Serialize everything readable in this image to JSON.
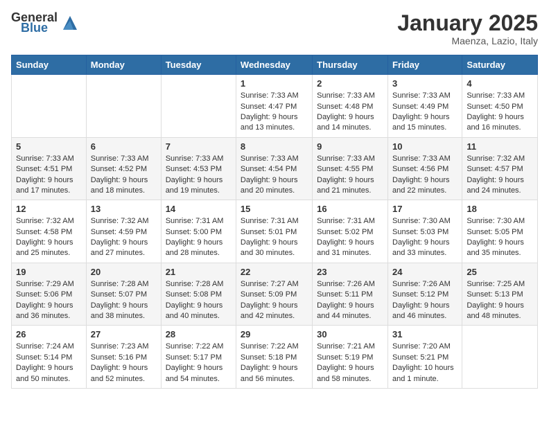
{
  "header": {
    "logo_general": "General",
    "logo_blue": "Blue",
    "month": "January 2025",
    "location": "Maenza, Lazio, Italy"
  },
  "weekdays": [
    "Sunday",
    "Monday",
    "Tuesday",
    "Wednesday",
    "Thursday",
    "Friday",
    "Saturday"
  ],
  "weeks": [
    [
      {
        "day": "",
        "info": ""
      },
      {
        "day": "",
        "info": ""
      },
      {
        "day": "",
        "info": ""
      },
      {
        "day": "1",
        "info": "Sunrise: 7:33 AM\nSunset: 4:47 PM\nDaylight: 9 hours and 13 minutes."
      },
      {
        "day": "2",
        "info": "Sunrise: 7:33 AM\nSunset: 4:48 PM\nDaylight: 9 hours and 14 minutes."
      },
      {
        "day": "3",
        "info": "Sunrise: 7:33 AM\nSunset: 4:49 PM\nDaylight: 9 hours and 15 minutes."
      },
      {
        "day": "4",
        "info": "Sunrise: 7:33 AM\nSunset: 4:50 PM\nDaylight: 9 hours and 16 minutes."
      }
    ],
    [
      {
        "day": "5",
        "info": "Sunrise: 7:33 AM\nSunset: 4:51 PM\nDaylight: 9 hours and 17 minutes."
      },
      {
        "day": "6",
        "info": "Sunrise: 7:33 AM\nSunset: 4:52 PM\nDaylight: 9 hours and 18 minutes."
      },
      {
        "day": "7",
        "info": "Sunrise: 7:33 AM\nSunset: 4:53 PM\nDaylight: 9 hours and 19 minutes."
      },
      {
        "day": "8",
        "info": "Sunrise: 7:33 AM\nSunset: 4:54 PM\nDaylight: 9 hours and 20 minutes."
      },
      {
        "day": "9",
        "info": "Sunrise: 7:33 AM\nSunset: 4:55 PM\nDaylight: 9 hours and 21 minutes."
      },
      {
        "day": "10",
        "info": "Sunrise: 7:33 AM\nSunset: 4:56 PM\nDaylight: 9 hours and 22 minutes."
      },
      {
        "day": "11",
        "info": "Sunrise: 7:32 AM\nSunset: 4:57 PM\nDaylight: 9 hours and 24 minutes."
      }
    ],
    [
      {
        "day": "12",
        "info": "Sunrise: 7:32 AM\nSunset: 4:58 PM\nDaylight: 9 hours and 25 minutes."
      },
      {
        "day": "13",
        "info": "Sunrise: 7:32 AM\nSunset: 4:59 PM\nDaylight: 9 hours and 27 minutes."
      },
      {
        "day": "14",
        "info": "Sunrise: 7:31 AM\nSunset: 5:00 PM\nDaylight: 9 hours and 28 minutes."
      },
      {
        "day": "15",
        "info": "Sunrise: 7:31 AM\nSunset: 5:01 PM\nDaylight: 9 hours and 30 minutes."
      },
      {
        "day": "16",
        "info": "Sunrise: 7:31 AM\nSunset: 5:02 PM\nDaylight: 9 hours and 31 minutes."
      },
      {
        "day": "17",
        "info": "Sunrise: 7:30 AM\nSunset: 5:03 PM\nDaylight: 9 hours and 33 minutes."
      },
      {
        "day": "18",
        "info": "Sunrise: 7:30 AM\nSunset: 5:05 PM\nDaylight: 9 hours and 35 minutes."
      }
    ],
    [
      {
        "day": "19",
        "info": "Sunrise: 7:29 AM\nSunset: 5:06 PM\nDaylight: 9 hours and 36 minutes."
      },
      {
        "day": "20",
        "info": "Sunrise: 7:28 AM\nSunset: 5:07 PM\nDaylight: 9 hours and 38 minutes."
      },
      {
        "day": "21",
        "info": "Sunrise: 7:28 AM\nSunset: 5:08 PM\nDaylight: 9 hours and 40 minutes."
      },
      {
        "day": "22",
        "info": "Sunrise: 7:27 AM\nSunset: 5:09 PM\nDaylight: 9 hours and 42 minutes."
      },
      {
        "day": "23",
        "info": "Sunrise: 7:26 AM\nSunset: 5:11 PM\nDaylight: 9 hours and 44 minutes."
      },
      {
        "day": "24",
        "info": "Sunrise: 7:26 AM\nSunset: 5:12 PM\nDaylight: 9 hours and 46 minutes."
      },
      {
        "day": "25",
        "info": "Sunrise: 7:25 AM\nSunset: 5:13 PM\nDaylight: 9 hours and 48 minutes."
      }
    ],
    [
      {
        "day": "26",
        "info": "Sunrise: 7:24 AM\nSunset: 5:14 PM\nDaylight: 9 hours and 50 minutes."
      },
      {
        "day": "27",
        "info": "Sunrise: 7:23 AM\nSunset: 5:16 PM\nDaylight: 9 hours and 52 minutes."
      },
      {
        "day": "28",
        "info": "Sunrise: 7:22 AM\nSunset: 5:17 PM\nDaylight: 9 hours and 54 minutes."
      },
      {
        "day": "29",
        "info": "Sunrise: 7:22 AM\nSunset: 5:18 PM\nDaylight: 9 hours and 56 minutes."
      },
      {
        "day": "30",
        "info": "Sunrise: 7:21 AM\nSunset: 5:19 PM\nDaylight: 9 hours and 58 minutes."
      },
      {
        "day": "31",
        "info": "Sunrise: 7:20 AM\nSunset: 5:21 PM\nDaylight: 10 hours and 1 minute."
      },
      {
        "day": "",
        "info": ""
      }
    ]
  ]
}
